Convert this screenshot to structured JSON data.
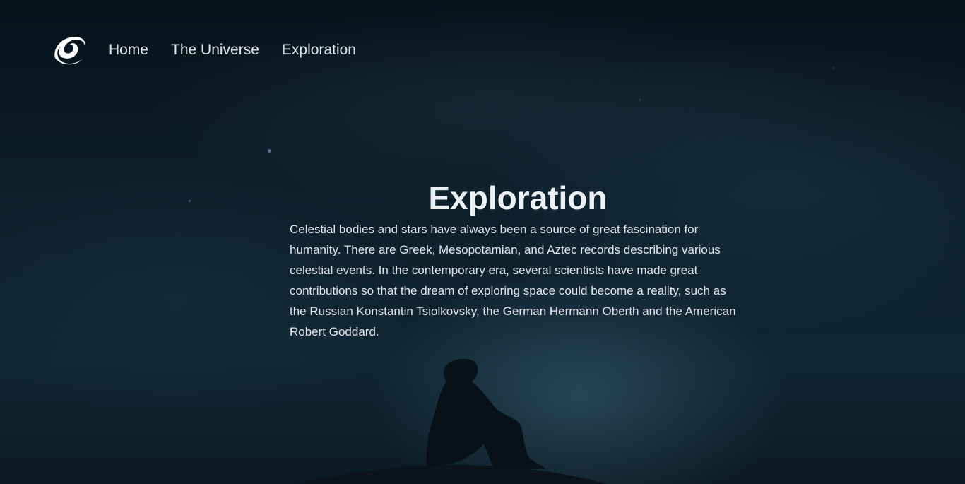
{
  "nav": {
    "logo_icon": "spiral-galaxy-icon",
    "links": [
      "Home",
      "The Universe",
      "Exploration"
    ]
  },
  "main": {
    "title": "Exploration",
    "paragraph": "Celestial bodies and stars have always been a source of great fascination for humanity. There are Greek, Mesopotamian, and Aztec records describing various celestial events. In the contemporary era, several scientists have made great contributions so that the dream of exploring space could become a reality, such as the Russian Konstantin Tsiolkovsky, the German Hermann Oberth and the American Robert Goddard."
  },
  "colors": {
    "background": "#0b1a24",
    "text": "#e6eaee"
  }
}
